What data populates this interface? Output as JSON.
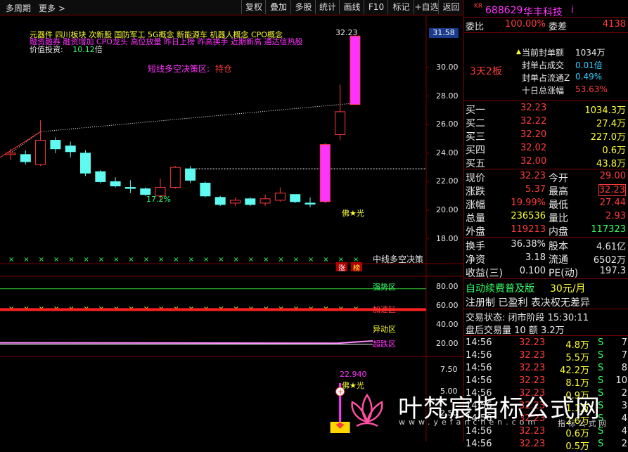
{
  "toolbar": {
    "period_label": "多周期",
    "more_label": "更多",
    "buttons": [
      "复权",
      "叠加",
      "多股",
      "统计",
      "画线",
      "F10",
      "标记",
      "+自选",
      "返回"
    ]
  },
  "chart": {
    "indicator_line1": "元器件    四川板块  次新股 国防军工 5G概念 新能源车 机器人概念 CPO概念",
    "indicator_line2": "融资融券 融资增加 CPO龙头 高位放量 昨日上榜 昨高换手 近期新高 通达信热股",
    "value_label": "价值投资:",
    "value_num": "10.12",
    "value_unit": "倍",
    "decision_label": "短线多空决策区:",
    "decision_value": "持仓",
    "pct_label": "17.2%",
    "star_label": "佛★光",
    "high_price": "32.23",
    "right_price_box": "31.58",
    "price_axis": [
      "30.00",
      "28.00",
      "26.00",
      "24.00",
      "22.00",
      "20.00",
      "18.00"
    ],
    "mid_label": "中线多空决策",
    "tag_zhang": "涨",
    "tag_bang": "榜",
    "zone_strong": "强势区",
    "zone_accel": "加速区",
    "zone_abnormal": "异动区",
    "zone_oversold": "超跌区",
    "osc_axis": [
      "80.00",
      "60.00",
      "40.00",
      "20.00"
    ],
    "sub_axis": [
      "7.50",
      "5.00",
      "2.50"
    ],
    "sub_value": "22.940",
    "sub_star": "佛★光",
    "watermark_cn": "叶梵宸指标公式网",
    "watermark_en": "www.yefanchen.com",
    "watermark_tail": "指  标  公  式  网"
  },
  "chart_data": {
    "type": "candlestick",
    "ylim": [
      17,
      33
    ],
    "candles": [
      {
        "o": 24.0,
        "c": 23.9,
        "h": 24.3,
        "l": 23.5,
        "up": true
      },
      {
        "o": 23.4,
        "c": 23.9,
        "h": 24.2,
        "l": 23.2,
        "up": false
      },
      {
        "o": 23.2,
        "c": 24.9,
        "h": 26.3,
        "l": 23.1,
        "up": true
      },
      {
        "o": 24.9,
        "c": 24.3,
        "h": 25.1,
        "l": 24.0,
        "up": false
      },
      {
        "o": 24.5,
        "c": 24.1,
        "h": 24.8,
        "l": 23.7,
        "up": false
      },
      {
        "o": 24.0,
        "c": 22.6,
        "h": 24.2,
        "l": 22.4,
        "up": false
      },
      {
        "o": 22.7,
        "c": 22.0,
        "h": 22.8,
        "l": 21.9,
        "up": false
      },
      {
        "o": 22.0,
        "c": 21.7,
        "h": 22.3,
        "l": 21.6,
        "up": false
      },
      {
        "o": 21.6,
        "c": 21.6,
        "h": 22.1,
        "l": 21.2,
        "up": false
      },
      {
        "o": 21.5,
        "c": 21.1,
        "h": 21.6,
        "l": 21.0,
        "up": false
      },
      {
        "o": 21.0,
        "c": 21.6,
        "h": 22.2,
        "l": 20.7,
        "up": true
      },
      {
        "o": 21.6,
        "c": 23.0,
        "h": 23.1,
        "l": 21.5,
        "up": true
      },
      {
        "o": 22.9,
        "c": 22.1,
        "h": 23.1,
        "l": 21.9,
        "up": false
      },
      {
        "o": 21.9,
        "c": 21.0,
        "h": 22.0,
        "l": 20.9,
        "up": false
      },
      {
        "o": 20.9,
        "c": 20.4,
        "h": 21.0,
        "l": 20.3,
        "up": false
      },
      {
        "o": 20.5,
        "c": 20.7,
        "h": 20.9,
        "l": 20.3,
        "up": true
      },
      {
        "o": 20.8,
        "c": 20.4,
        "h": 20.9,
        "l": 20.3,
        "up": false
      },
      {
        "o": 20.5,
        "c": 20.8,
        "h": 21.1,
        "l": 20.3,
        "up": true
      },
      {
        "o": 20.7,
        "c": 21.2,
        "h": 21.6,
        "l": 20.6,
        "up": true
      },
      {
        "o": 21.1,
        "c": 20.6,
        "h": 21.1,
        "l": 20.5,
        "up": false
      },
      {
        "o": 20.5,
        "c": 20.5,
        "h": 20.9,
        "l": 20.2,
        "up": false
      },
      {
        "o": 20.6,
        "c": 24.6,
        "h": 24.7,
        "l": 20.5,
        "up": true,
        "special": true
      },
      {
        "o": 25.3,
        "c": 26.9,
        "h": 28.8,
        "l": 24.9,
        "up": true
      },
      {
        "o": 27.4,
        "c": 32.2,
        "h": 32.23,
        "l": 27.4,
        "up": true,
        "special": true
      }
    ],
    "dashed_resistance": 22.9,
    "trend_points": [
      [
        0,
        24.0
      ],
      [
        2,
        25.5
      ],
      [
        23,
        27.5
      ]
    ],
    "osc_line_value": 21.0,
    "osc_red_band": 56,
    "osc_green": 78
  },
  "panel": {
    "tag": "KR",
    "code": "688629",
    "name": "华丰科技",
    "info_icon": "i",
    "weibi_label": "委比",
    "weibi_value": "100.00%",
    "weicha_label": "委差",
    "weicha_value": "4138",
    "board_days": "3天2板",
    "stats": [
      {
        "label": "当前封单额",
        "value": "1034万",
        "cls": "wht"
      },
      {
        "label": "封单占成交",
        "value": "0.01倍",
        "cls": "cyan"
      },
      {
        "label": "封单占流通Z",
        "value": "0.49%",
        "cls": "cyan"
      },
      {
        "label": "十日总涨幅",
        "value": "53.63%",
        "cls": "red"
      }
    ],
    "buy": [
      {
        "label": "买一",
        "price": "32.23",
        "vol": "1034.3万"
      },
      {
        "label": "买二",
        "price": "32.22",
        "vol": "27.4万"
      },
      {
        "label": "买三",
        "price": "32.20",
        "vol": "227.0万"
      },
      {
        "label": "买四",
        "price": "32.02",
        "vol": "0.6万"
      },
      {
        "label": "买五",
        "price": "32.00",
        "vol": "43.8万"
      }
    ],
    "quote": [
      {
        "l1": "现价",
        "v1": "32.23",
        "c1": "red",
        "l2": "今开",
        "v2": "29.00",
        "c2": "red"
      },
      {
        "l1": "涨跌",
        "v1": "5.37",
        "c1": "red",
        "l2": "最高",
        "v2": "32.23",
        "c2": "red"
      },
      {
        "l1": "涨幅",
        "v1": "19.99%",
        "c1": "red",
        "l2": "最低",
        "v2": "27.44",
        "c2": "red"
      },
      {
        "l1": "总量",
        "v1": "236536",
        "c1": "yel",
        "l2": "量比",
        "v2": "2.93",
        "c2": "red"
      },
      {
        "l1": "外盘",
        "v1": "119213",
        "c1": "red",
        "l2": "内盘",
        "v2": "117323",
        "c2": "grn"
      }
    ],
    "fund": [
      {
        "l1": "换手",
        "v1": "36.38%",
        "l2": "股本",
        "v2": "4.61亿"
      },
      {
        "l1": "净资",
        "v1": "3.18",
        "l2": "流通",
        "v2": "6502万"
      },
      {
        "l1": "收益(三)",
        "v1": "0.100",
        "l2": "PE(动)",
        "v2": "197.3"
      }
    ],
    "promo_left": "自动续费普及版",
    "promo_price": "30元/月",
    "reg_text": "注册制 已盈利 表决权无差异",
    "trade_state": "交易状态: 闭市阶段 15:30:11",
    "after_hours": "盘后交易量 10 额 3.2万",
    "ticks": [
      {
        "t": "14:56",
        "p": "32.23",
        "v": "4.8万",
        "s": "S",
        "n": "7"
      },
      {
        "t": "14:56",
        "p": "32.23",
        "v": "5.5万",
        "s": "S",
        "n": "7"
      },
      {
        "t": "14:56",
        "p": "32.23",
        "v": "42.2万",
        "s": "S",
        "n": "8"
      },
      {
        "t": "14:56",
        "p": "32.23",
        "v": "8.1万",
        "s": "S",
        "n": "10"
      },
      {
        "t": "14:56",
        "p": "32.23",
        "v": "0.9万",
        "s": "S",
        "n": "2"
      },
      {
        "t": "14:56",
        "p": "32.23",
        "v": "1.1万",
        "s": "S",
        "n": "3"
      },
      {
        "t": "14:56",
        "p": "32.23",
        "v": "2.6万",
        "s": "S",
        "n": "4"
      },
      {
        "t": "14:56",
        "p": "32.23",
        "v": "0.6万",
        "s": "S",
        "n": "4"
      },
      {
        "t": "14:56",
        "p": "32.23",
        "v": "0.5万",
        "s": "S",
        "n": "2"
      }
    ]
  }
}
